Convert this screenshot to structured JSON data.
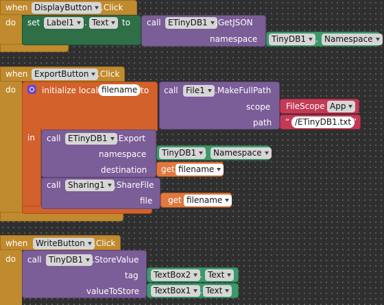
{
  "colors": {
    "control": "#c08a2e",
    "procedure": "#7b5d97",
    "setter": "#2e6f48",
    "component": "#3c9a6a",
    "variable": "#d2612b",
    "text": "#c43a55"
  },
  "icons": {
    "mutator": "gear-icon",
    "dropdown": "chevron-down-icon"
  },
  "event1": {
    "kw_when": "when",
    "component": "DisplayButton",
    "event": ".Click",
    "kw_do": "do",
    "set_kw": "set",
    "set_component": "Label1",
    "set_dot": ".",
    "set_property": "Text",
    "set_to": "to",
    "call_kw": "call",
    "call_component": "ETinyDB1",
    "call_method": ".GetJSON",
    "arg_label": "namespace",
    "arg_component": "TinyDB1",
    "arg_dot": ".",
    "arg_property": "Namespace"
  },
  "event2": {
    "kw_when": "when",
    "component": "ExportButton",
    "event": ".Click",
    "kw_do": "do",
    "init_kw": "initialize local",
    "var_name": "filename",
    "init_to": "to",
    "make_call": "call",
    "make_component": "File1",
    "make_method": ".MakeFullPath",
    "scope_label": "scope",
    "scope_component": "FileScope",
    "scope_value": "App",
    "path_label": "path",
    "quote_open": "“",
    "path_value": "/ETinyDB1.txt",
    "quote_close": "”",
    "in_kw": "in",
    "export_call": "call",
    "export_component": "ETinyDB1",
    "export_method": ".Export",
    "ns_label": "namespace",
    "ns_component": "TinyDB1",
    "ns_dot": ".",
    "ns_property": "Namespace",
    "dest_label": "destination",
    "get_kw": "get",
    "get_var": "filename",
    "share_call": "call",
    "share_component": "Sharing1",
    "share_method": ".ShareFile",
    "file_label": "file",
    "file_get_kw": "get",
    "file_get_var": "filename"
  },
  "event3": {
    "kw_when": "when",
    "component": "WriteButton",
    "event": ".Click",
    "kw_do": "do",
    "call_kw": "call",
    "call_component": "TinyDB1",
    "call_method": ".StoreValue",
    "tag_label": "tag",
    "tag_component": "TextBox2",
    "tag_dot": ".",
    "tag_property": "Text",
    "value_label": "valueToStore",
    "value_component": "TextBox1",
    "value_dot": ".",
    "value_property": "Text"
  }
}
